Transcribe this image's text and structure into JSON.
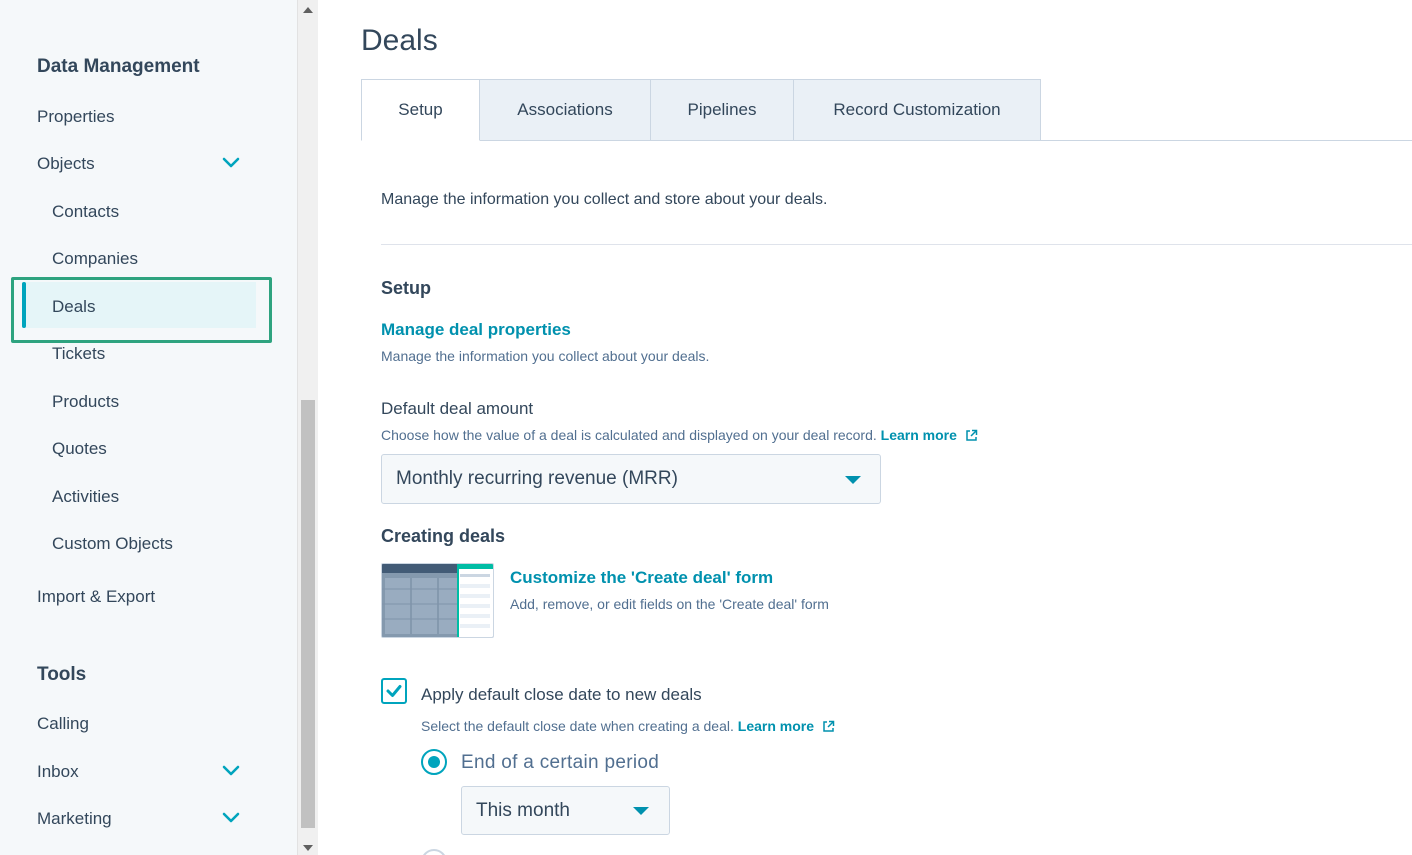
{
  "sidebar": {
    "data_management_heading": "Data Management",
    "items": {
      "properties": "Properties",
      "objects": "Objects",
      "contacts": "Contacts",
      "companies": "Companies",
      "deals": "Deals",
      "tickets": "Tickets",
      "products": "Products",
      "quotes": "Quotes",
      "activities": "Activities",
      "custom_objects": "Custom Objects",
      "import_export": "Import & Export"
    },
    "tools_heading": "Tools",
    "tools": {
      "calling": "Calling",
      "inbox": "Inbox",
      "marketing": "Marketing"
    },
    "active_item": "Deals",
    "expand_icon": "chevron-down-icon"
  },
  "main": {
    "title": "Deals",
    "tabs": [
      "Setup",
      "Associations",
      "Pipelines",
      "Record Customization"
    ],
    "active_tab": "Setup",
    "intro": "Manage the information you collect and store about your deals.",
    "setup": {
      "heading": "Setup",
      "manage_link": "Manage deal properties",
      "manage_desc": "Manage the information you collect about your deals."
    },
    "default_amount": {
      "label": "Default deal amount",
      "desc": "Choose how the value of a deal is calculated and displayed on your deal record.",
      "learn_more": "Learn more",
      "selected": "Monthly recurring revenue (MRR)"
    },
    "creating": {
      "heading": "Creating deals",
      "customize_link": "Customize the 'Create deal' form",
      "customize_desc": "Add, remove, or edit fields on the 'Create deal' form"
    },
    "close_date": {
      "checkbox_label": "Apply default close date to new deals",
      "checked": true,
      "desc": "Select the default close date when creating a deal.",
      "learn_more": "Learn more",
      "radio_label": "End of a certain period",
      "period_selected": "This month"
    }
  },
  "colors": {
    "accent": "#00a4bd",
    "link": "#0091ae",
    "text": "#33475b",
    "highlight_border": "#2ea37f",
    "sidebar_bg": "#f5f8fa"
  }
}
